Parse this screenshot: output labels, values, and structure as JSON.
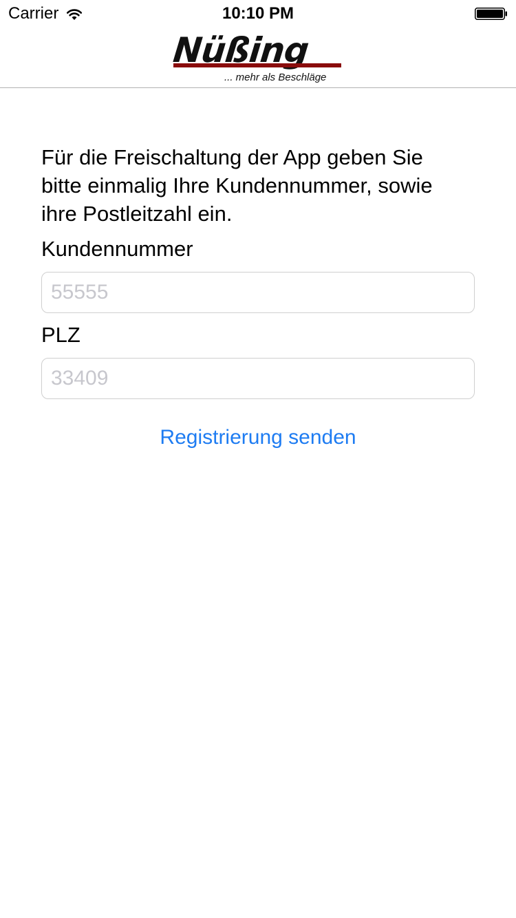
{
  "status_bar": {
    "carrier": "Carrier",
    "time": "10:10 PM",
    "wifi_icon": "wifi-icon",
    "battery_icon": "battery-icon"
  },
  "header": {
    "logo_text": "Nüßing",
    "logo_tagline": "... mehr als Beschläge",
    "logo_accent_color": "#8a0c0c"
  },
  "form": {
    "intro": "Für die Freischaltung der App geben Sie bitte einmalig Ihre Kundennummer, sowie ihre Postleitzahl ein.",
    "customer_number_label": "Kundennummer",
    "customer_number_placeholder": "55555",
    "customer_number_value": "",
    "zip_label": "PLZ",
    "zip_placeholder": "33409",
    "zip_value": "",
    "submit_label": "Registrierung senden",
    "accent_color": "#1e7cf2"
  }
}
